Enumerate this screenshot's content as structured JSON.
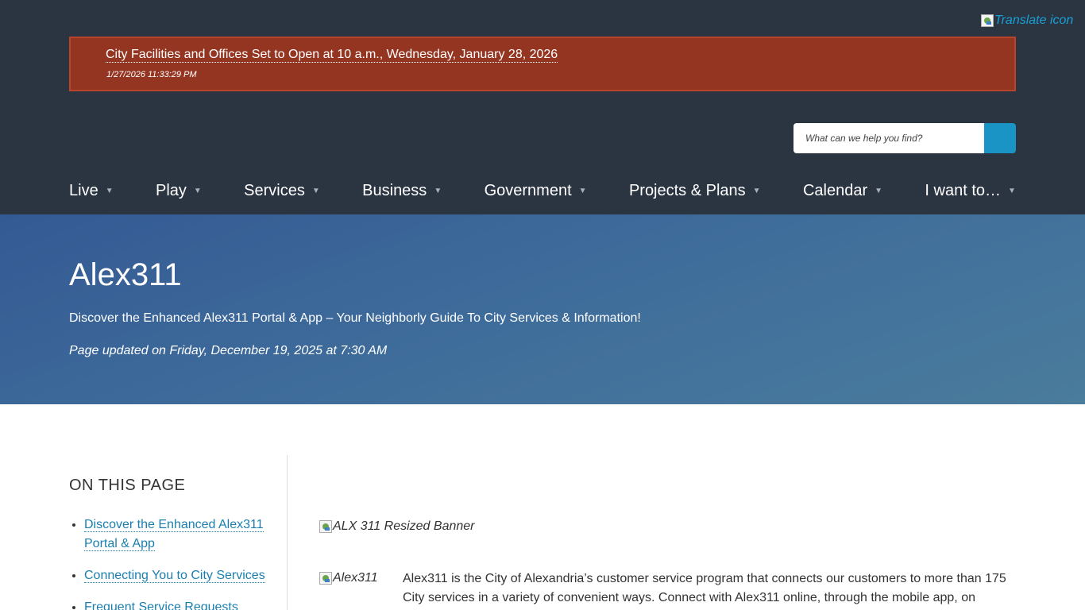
{
  "translate": {
    "alt": "Translate icon"
  },
  "alert": {
    "title": "City Facilities and Offices Set to Open at 10 a.m., Wednesday, January 28, 2026",
    "timestamp": "1/27/2026 11:33:29 PM"
  },
  "search": {
    "placeholder": "What can we help you find?"
  },
  "nav": {
    "caret": "▼",
    "items": [
      {
        "label": "Live"
      },
      {
        "label": "Play"
      },
      {
        "label": "Services"
      },
      {
        "label": "Business"
      },
      {
        "label": "Government"
      },
      {
        "label": "Projects & Plans"
      },
      {
        "label": "Calendar"
      },
      {
        "label": "I want to…"
      }
    ]
  },
  "hero": {
    "title": "Alex311",
    "subtitle": "Discover the Enhanced Alex311 Portal & App – Your Neighborly Guide To City Services & Information!",
    "updated": "Page updated on Friday, December 19, 2025 at 7:30 AM"
  },
  "sidebar": {
    "heading": "ON THIS PAGE",
    "links": [
      {
        "label": "Discover the Enhanced Alex311 Portal & App"
      },
      {
        "label": "Connecting You to City Services"
      },
      {
        "label": "Frequent Service Requests"
      }
    ]
  },
  "content": {
    "banner_alt": "ALX 311 Resized Banner",
    "logo_alt": "Alex311",
    "intro": "Alex311 is the City of Alexandria’s customer service program that connects our customers to more than 175 City services in a variety of convenient ways. Connect with Alex311 online, through the mobile app, on"
  },
  "colors": {
    "header_bg": "#2b3542",
    "alert_bg": "#943522",
    "accent": "#1a94c4",
    "link": "#1a7fb0"
  }
}
